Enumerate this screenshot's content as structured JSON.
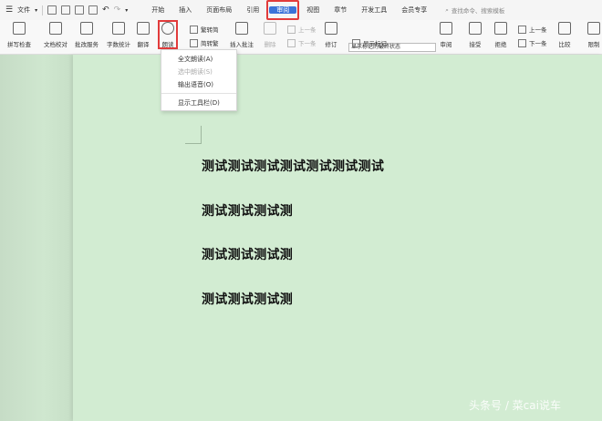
{
  "menubar": {
    "file_label": "文件",
    "tabs": [
      "开始",
      "插入",
      "页面布局",
      "引用",
      "审阅",
      "视图",
      "章节",
      "开发工具",
      "会员专享"
    ],
    "active_tab": "审阅",
    "search_placeholder": "查找命令、搜索模板"
  },
  "ribbon": {
    "spellcheck": "拼写检查",
    "doc_proof": "文档校对",
    "paper_check": "批改服务",
    "word_count": "字数统计",
    "translate": "翻译",
    "read_aloud": "朗读",
    "trad_to_simp": "繁转简",
    "simp_to_trad": "简转繁",
    "insert_comment": "插入批注",
    "delete": "删除",
    "prev_comment": "上一条",
    "next_comment": "下一条",
    "revise": "修订",
    "display_mode": "显示标记的最终状态",
    "show_markup": "显示标记",
    "review": "审阅",
    "accept": "接受",
    "reject": "拒绝",
    "prev_change": "上一条",
    "next_change": "下一条",
    "compare": "比较",
    "restrict": "限制"
  },
  "dropdown": {
    "items": [
      "全文朗读(A)",
      "选中朗读(S)",
      "输出语音(O)"
    ],
    "disabled_index": 1,
    "toolbar_item": "显示工具栏(D)"
  },
  "document": {
    "lines": [
      "测试测试测试测试测试测试测试",
      "测试测试测试测",
      "测试测试测试测",
      "测试测试测试测"
    ]
  },
  "watermark": "头条号 / 菜cai说车"
}
